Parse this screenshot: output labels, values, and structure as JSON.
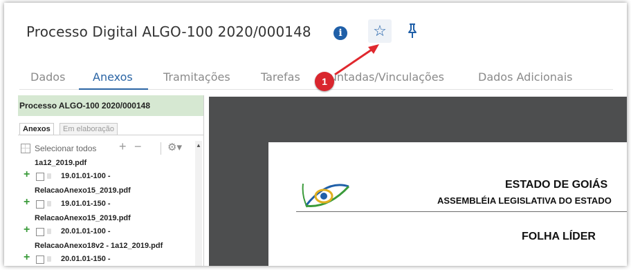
{
  "header": {
    "title": "Processo Digital ALGO-100 2020/000148",
    "info_icon": "info-icon",
    "star_icon": "star-outline-icon",
    "pin_icon": "pin-icon"
  },
  "annotation": {
    "badge_number": "1",
    "badge_color": "#d9262e"
  },
  "tabs": [
    {
      "label": "Dados",
      "active": false
    },
    {
      "label": "Anexos",
      "active": true
    },
    {
      "label": "Tramitações",
      "active": false
    },
    {
      "label": "Tarefas",
      "active": false
    },
    {
      "label": "Juntadas/Vinculações",
      "active": false
    },
    {
      "label": "Dados Adicionais",
      "active": false
    }
  ],
  "panel": {
    "header": "Processo ALGO-100 2020/000148",
    "subtabs": [
      "Anexos",
      "Em elaboração"
    ],
    "select_all": "Selecionar todos",
    "tree": [
      {
        "type": "name",
        "text": "1a12_2019.pdf"
      },
      {
        "type": "row",
        "code": "19.01.01-100 -"
      },
      {
        "type": "name",
        "text": "RelacaoAnexo15_2019.pdf"
      },
      {
        "type": "row",
        "code": "19.01.01-150 -"
      },
      {
        "type": "name",
        "text": "RelacaoAnexo15_2019.pdf"
      },
      {
        "type": "row",
        "code": "20.01.01-100 -"
      },
      {
        "type": "name",
        "text": "RelacaoAnexo18v2 - 1a12_2019.pdf"
      },
      {
        "type": "row",
        "code": "20.01.01-150 -"
      }
    ]
  },
  "document": {
    "title": "ESTADO DE GOIÁS",
    "subtitle": "ASSEMBLÉIA LEGISLATIVA DO ESTADO",
    "heading": "FOLHA LÍDER"
  },
  "colors": {
    "accent": "#2a64a4",
    "panel_header_bg": "#d6e8d2",
    "viewer_bg": "#4d4e4f"
  }
}
